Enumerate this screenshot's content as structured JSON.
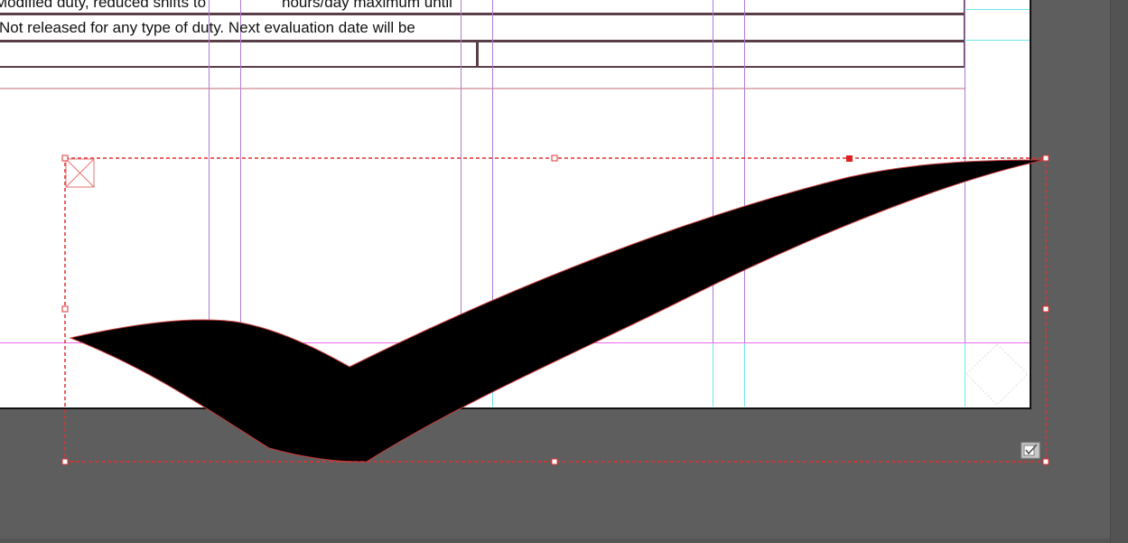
{
  "document": {
    "row1_left_text": "Modified duty, reduced shifts to",
    "row1_right_text": "hours/day maximum until",
    "row2_text": "Not released for any type of duty. Next evaluation date will be"
  },
  "selection": {
    "object_icon": "graphic-frame-placeholder-icon",
    "content_indicator_icon": "checkbox-checked-icon"
  },
  "colors": {
    "pasteboard": "#5e5e5e",
    "page": "#ffffff",
    "frame_border": "#5a3e4a",
    "selection": "#e03030",
    "guide_violet": "#b07ad8",
    "guide_cyan": "#6fe6ec",
    "guide_magenta": "#ee66ee",
    "baseline": "#c46a78",
    "checkmark_fill": "#000000"
  }
}
